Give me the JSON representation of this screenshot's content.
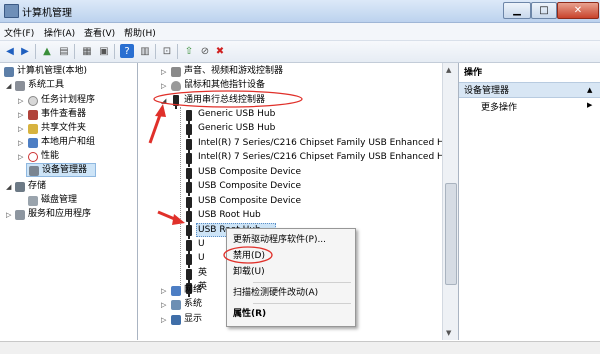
{
  "window": {
    "title": "计算机管理",
    "min": "▁",
    "max": "□",
    "close": "✕"
  },
  "menu": [
    "文件(F)",
    "操作(A)",
    "查看(V)",
    "帮助(H)"
  ],
  "left_tree": {
    "root": "计算机管理(本地)",
    "system_tools": "系统工具",
    "items": [
      "任务计划程序",
      "事件查看器",
      "共享文件夹",
      "本地用户和组",
      "性能",
      "设备管理器"
    ],
    "storage": "存储",
    "disk": "磁盘管理",
    "services": "服务和应用程序"
  },
  "device_tree": {
    "top": [
      "声音、视频和游戏控制器",
      "鼠标和其他指针设备"
    ],
    "usb_controller": "通用串行总线控制器",
    "usb_items": [
      "Generic USB Hub",
      "Generic USB Hub",
      "Intel(R) 7 Series/C216 Chipset Family USB Enhanced Host",
      "Intel(R) 7 Series/C216 Chipset Family USB Enhanced Host",
      "USB Composite Device",
      "USB Composite Device",
      "USB Composite Device",
      "USB Root Hub",
      "USB Root Hub",
      "U",
      "U",
      "英",
      "英"
    ],
    "bottom": [
      "网络",
      "系统",
      "显示"
    ]
  },
  "context_menu": {
    "update": "更新驱动程序软件(P)...",
    "disable": "禁用(D)",
    "uninstall": "卸载(U)",
    "scan": "扫描检测硬件改动(A)",
    "properties": "属性(R)"
  },
  "actions": {
    "header": "操作",
    "section": "设备管理器",
    "more": "更多操作"
  },
  "colors": {
    "annotation": "#e0302a",
    "selection": "#cde4f7"
  }
}
